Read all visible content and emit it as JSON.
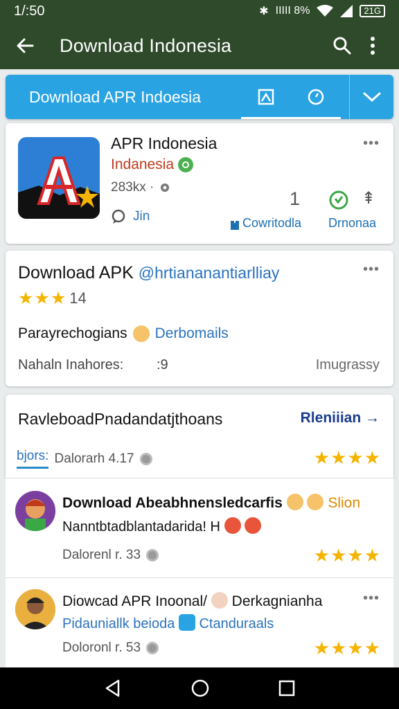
{
  "status": {
    "time": "1/:50",
    "signal_text": "IIIII 8%",
    "battery_text": "21G"
  },
  "appbar": {
    "title": "Download Indonesia"
  },
  "tabbar": {
    "title": "Download APR Indoesia"
  },
  "app": {
    "name": "APR Indonesia",
    "developer": "Indanesia",
    "size": "283kx ·",
    "comment": "Jin",
    "number": "1",
    "download_label": "Cowritodla",
    "download2_label": "Drnonaa",
    "more": "•••"
  },
  "info": {
    "title": "Download APK",
    "handle": "@hrtiananantiarlliay",
    "rating_stars": "★★★",
    "rating_count": "14",
    "meta_text": "Parayrechogians",
    "meta_tag": "Derbomails",
    "bottom_left": "Nahaln Inahores:",
    "bottom_mid": ":9",
    "bottom_right": "Imugrassy",
    "more": "•••"
  },
  "reviews_header": {
    "title": "RavleboadPnadandatjthoans",
    "link": "Rleniiian →",
    "tab_label": "bjors:",
    "tab_text": "Dalorarh 4.17",
    "stars": "★★★★"
  },
  "reviews": [
    {
      "title": "Download Abeabhnensledcarfis",
      "tag": "Slion",
      "subtitle": "Nanntbtadblantadarida! H",
      "date": "Dalorenl r. 33",
      "stars": "★★★★"
    },
    {
      "title": "Diowcad APR Inoonal/",
      "title2": "Derkagnianha",
      "subtitle": "Pidauniallk beioda",
      "subtag": "Ctanduraals",
      "date": "Doloronl r. 53",
      "stars": "★★★★",
      "more": "•••"
    }
  ],
  "colors": {
    "appbar": "#2e4a2a",
    "tabbar": "#2aa3e3",
    "star": "#f4b400",
    "link": "#2a72c0"
  }
}
